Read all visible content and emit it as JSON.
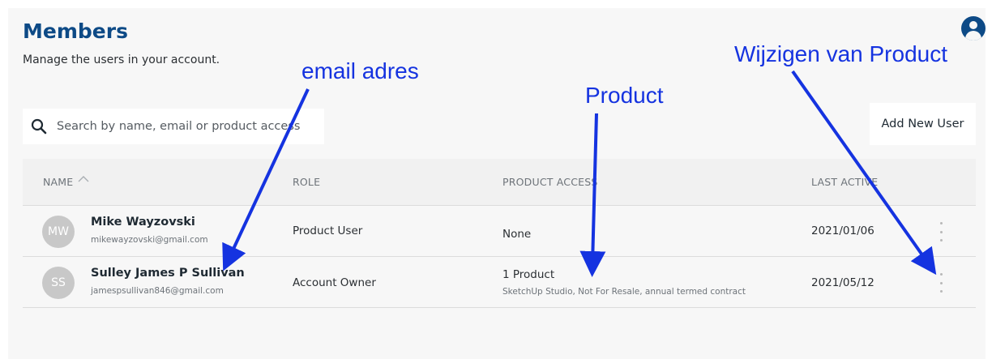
{
  "page": {
    "title": "Members",
    "subtitle": "Manage the users in your account.",
    "account_icon": "user-circle-icon"
  },
  "search": {
    "placeholder": "Search by name, email or product access",
    "icon": "search-icon"
  },
  "actions": {
    "add_user_label": "Add New User"
  },
  "table": {
    "columns": [
      "NAME",
      "ROLE",
      "PRODUCT ACCESS",
      "LAST ACTIVE"
    ],
    "rows": [
      {
        "initials": "MW",
        "name": "Mike Wayzovski",
        "email": "mikewayzovski@gmail.com",
        "role": "Product User",
        "product_access": "None",
        "product_detail": "",
        "last_active": "2021/01/06"
      },
      {
        "initials": "SS",
        "name": "Sulley James P Sullivan",
        "email": "jamespsullivan846@gmail.com",
        "role": "Account Owner",
        "product_access": "1 Product",
        "product_detail": "SketchUp Studio, Not For Resale, annual termed contract",
        "last_active": "2021/05/12"
      }
    ]
  },
  "annotations": {
    "email": "email adres",
    "product": "Product",
    "change": "Wijzigen van Product"
  },
  "colors": {
    "brand": "#0d4a86",
    "annotation": "#1533e0",
    "avatar": "#c8c8c8"
  }
}
